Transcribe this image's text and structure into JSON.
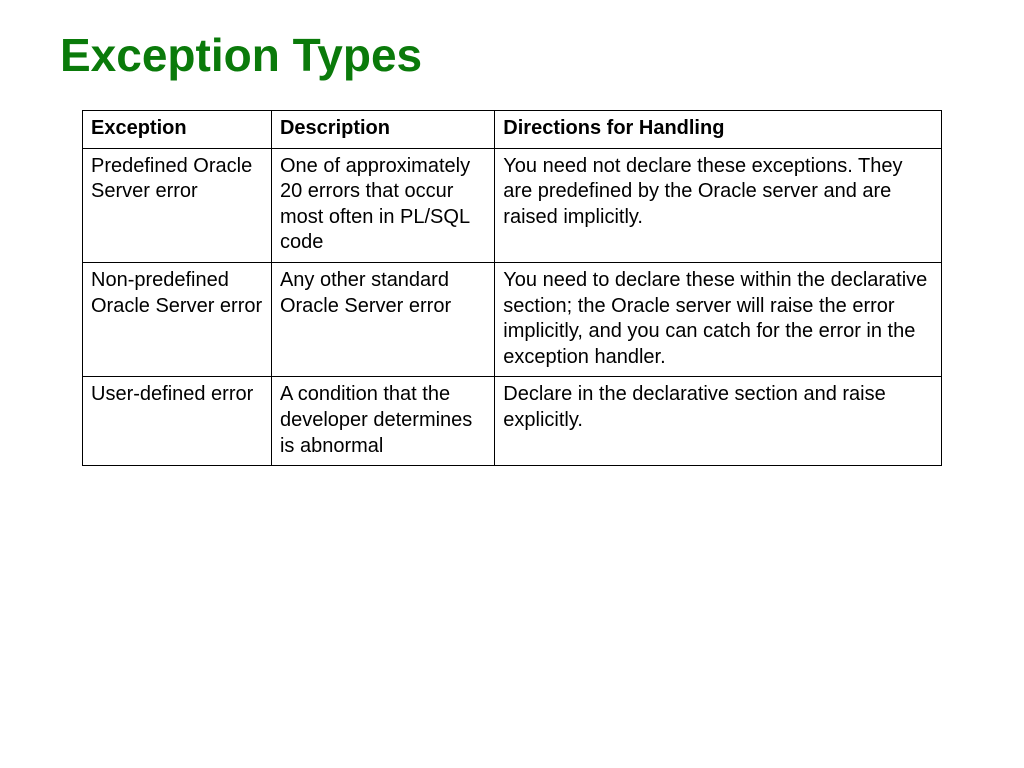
{
  "title": "Exception Types",
  "table": {
    "headers": {
      "exception": "Exception",
      "description": "Description",
      "directions": "Directions for Handling"
    },
    "rows": [
      {
        "exception": "Predefined Oracle Server error",
        "description": "One of approximately 20 errors that occur most often in PL/SQL code",
        "directions": "You need not declare these exceptions. They are predefined by the Oracle server and are raised implicitly."
      },
      {
        "exception": "Non-predefined Oracle Server error",
        "description": "Any other standard Oracle Server error",
        "directions": "You need to declare these within the declarative section; the Oracle server will raise the error implicitly, and you can catch for the error in the exception handler."
      },
      {
        "exception": "User-defined error",
        "description": "A condition that the developer determines is abnormal",
        "directions": "Declare in the declarative section and raise explicitly."
      }
    ]
  }
}
